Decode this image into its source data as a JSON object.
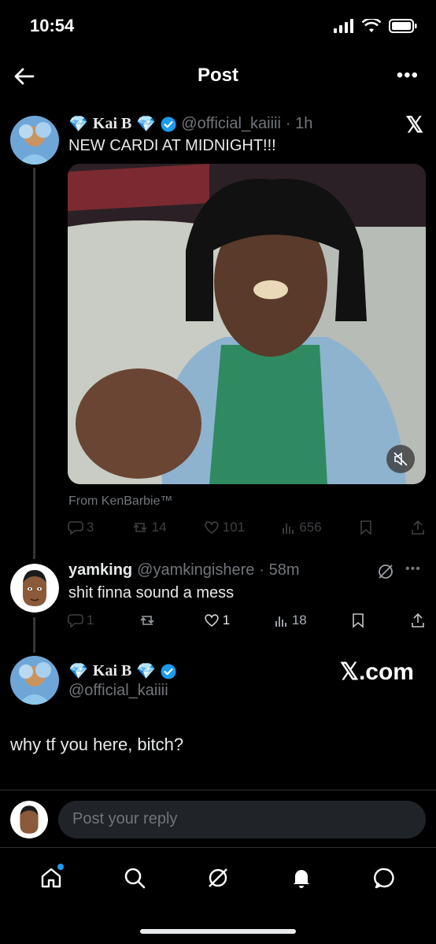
{
  "status_bar": {
    "time": "10:54"
  },
  "header": {
    "title": "Post"
  },
  "main_post": {
    "name": "Kai B",
    "handle": "@official_kaiiii",
    "time": "· 1h",
    "text": "NEW CARDI AT MIDNIGHT!!!",
    "from": "From KenBarbie™",
    "replies": "3",
    "reposts": "14",
    "likes": "101",
    "views": "656"
  },
  "reply_post": {
    "name": "yamking",
    "handle": "@yamkingishere",
    "time": "· 58m",
    "text": "shit finna sound a mess",
    "replies": "1",
    "reposts": "",
    "likes": "1",
    "views": "18"
  },
  "quoted_post": {
    "name": "Kai B",
    "handle": "@official_kaiiii",
    "text": "why tf you here, bitch?"
  },
  "watermark": {
    "x_logo": "𝕏",
    "site": "𝕏.com"
  },
  "reply_bar": {
    "placeholder": "Post your reply"
  },
  "colors": {
    "accent": "#1d9bf0",
    "muted": "#71767b",
    "background": "#000000"
  }
}
